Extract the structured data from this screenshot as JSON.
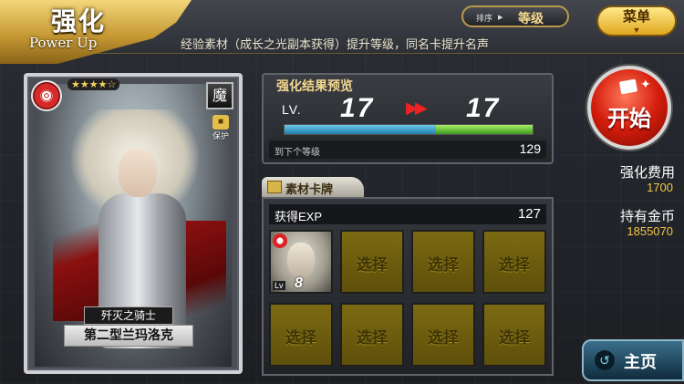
{
  "header": {
    "title": "强化",
    "subtitle": "Power Up",
    "hint": "经验素材（成长之光副本获得）提升等级，同名卡提升名声",
    "sort_key": "排序",
    "sort_value": "等级",
    "menu_label": "菜单"
  },
  "card": {
    "rarity_stars": "★★★★☆",
    "race": "魔",
    "lock_label": "保护",
    "title": "歼灭之骑士",
    "name": "第二型兰玛洛克"
  },
  "preview": {
    "title": "强化结果预览",
    "lv_label": "LV.",
    "level_from": "17",
    "level_to": "17",
    "exp_bar": {
      "current_fraction": 0.61,
      "gain_fraction": 0.39
    },
    "next_label": "到下个等级",
    "next_value": "129"
  },
  "materials": {
    "tab_label": "素材卡牌",
    "exp_label": "获得EXP",
    "exp_value": "127",
    "slots": [
      {
        "type": "card",
        "lv_label": "Lv",
        "level": "8"
      },
      {
        "type": "empty",
        "label": "选择"
      },
      {
        "type": "empty",
        "label": "选择"
      },
      {
        "type": "empty",
        "label": "选择"
      },
      {
        "type": "empty",
        "label": "选择"
      },
      {
        "type": "empty",
        "label": "选择"
      },
      {
        "type": "empty",
        "label": "选择"
      },
      {
        "type": "empty",
        "label": "选择"
      }
    ]
  },
  "actions": {
    "start_label": "开始",
    "cost_label": "强化费用",
    "cost_value": "1700",
    "gold_label": "持有金币",
    "gold_value": "1855070",
    "home_label": "主页"
  },
  "colors": {
    "accent_gold": "#f4c64a",
    "start_red": "#d41d0c",
    "slot_olive": "#6d5c0e"
  }
}
